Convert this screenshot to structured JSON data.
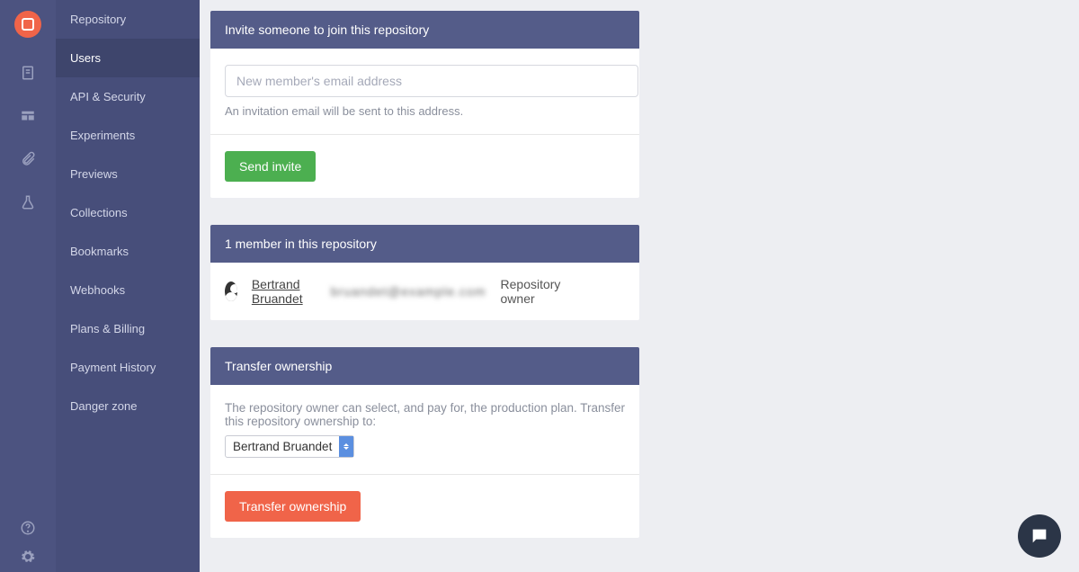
{
  "sidebar": {
    "items": [
      {
        "label": "Repository"
      },
      {
        "label": "Users"
      },
      {
        "label": "API & Security"
      },
      {
        "label": "Experiments"
      },
      {
        "label": "Previews"
      },
      {
        "label": "Collections"
      },
      {
        "label": "Bookmarks"
      },
      {
        "label": "Webhooks"
      },
      {
        "label": "Plans & Billing"
      },
      {
        "label": "Payment History"
      },
      {
        "label": "Danger zone"
      }
    ],
    "activeIndex": 1
  },
  "invite": {
    "header": "Invite someone to join this repository",
    "placeholder": "New member's email address",
    "hint": "An invitation email will be sent to this address.",
    "button": "Send invite"
  },
  "members": {
    "header": "1 member in this repository",
    "list": [
      {
        "name": "Bertrand Bruandet",
        "email": "bruandet@example.com",
        "role": "Repository owner"
      }
    ]
  },
  "transfer": {
    "header": "Transfer ownership",
    "description": "The repository owner can select, and pay for, the production plan. Transfer this repository ownership to:",
    "selected": "Bertrand Bruandet",
    "button": "Transfer ownership"
  }
}
